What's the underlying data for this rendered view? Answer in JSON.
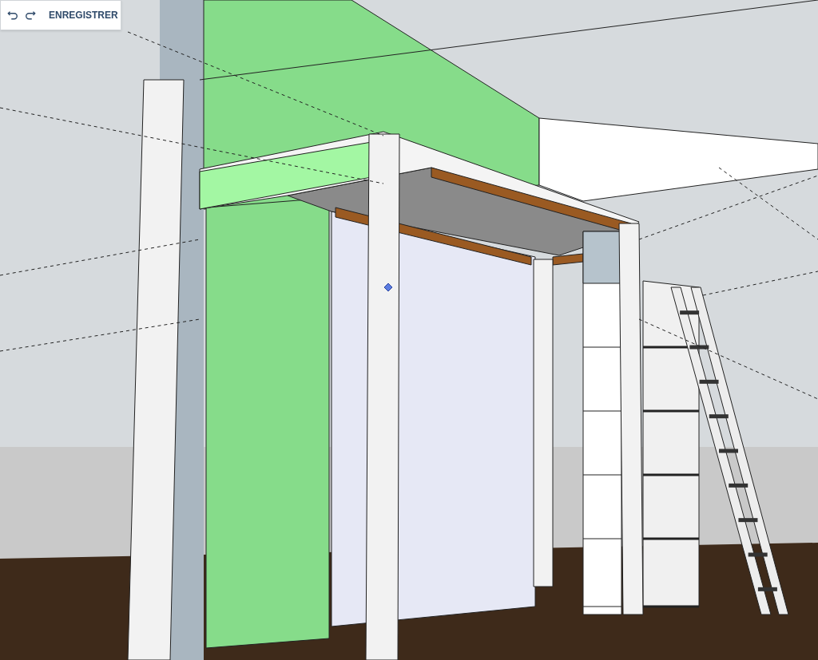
{
  "toolbar": {
    "save_button": "ENREGISTRER"
  }
}
